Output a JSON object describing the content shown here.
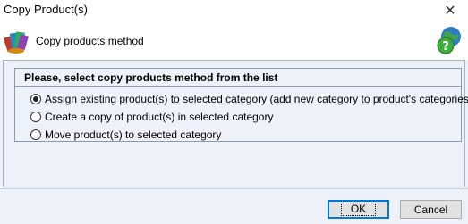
{
  "window": {
    "title": "Copy Product(s)",
    "close_glyph": "✕"
  },
  "header": {
    "label": "Copy products method",
    "icon": "products-icon",
    "help_icon": "help-globe-icon"
  },
  "group": {
    "title": "Please, select copy products method from the list",
    "options": [
      {
        "label": "Assign existing product(s) to selected category (add new category to product's categories)",
        "checked": true
      },
      {
        "label": "Create a copy of product(s) in selected category",
        "checked": false
      },
      {
        "label": "Move product(s) to selected category",
        "checked": false
      }
    ]
  },
  "buttons": {
    "ok": "OK",
    "cancel": "Cancel"
  },
  "colors": {
    "client_bg": "#eef2f8",
    "border": "#8a9ab0",
    "default_button_border": "#0078d7"
  }
}
